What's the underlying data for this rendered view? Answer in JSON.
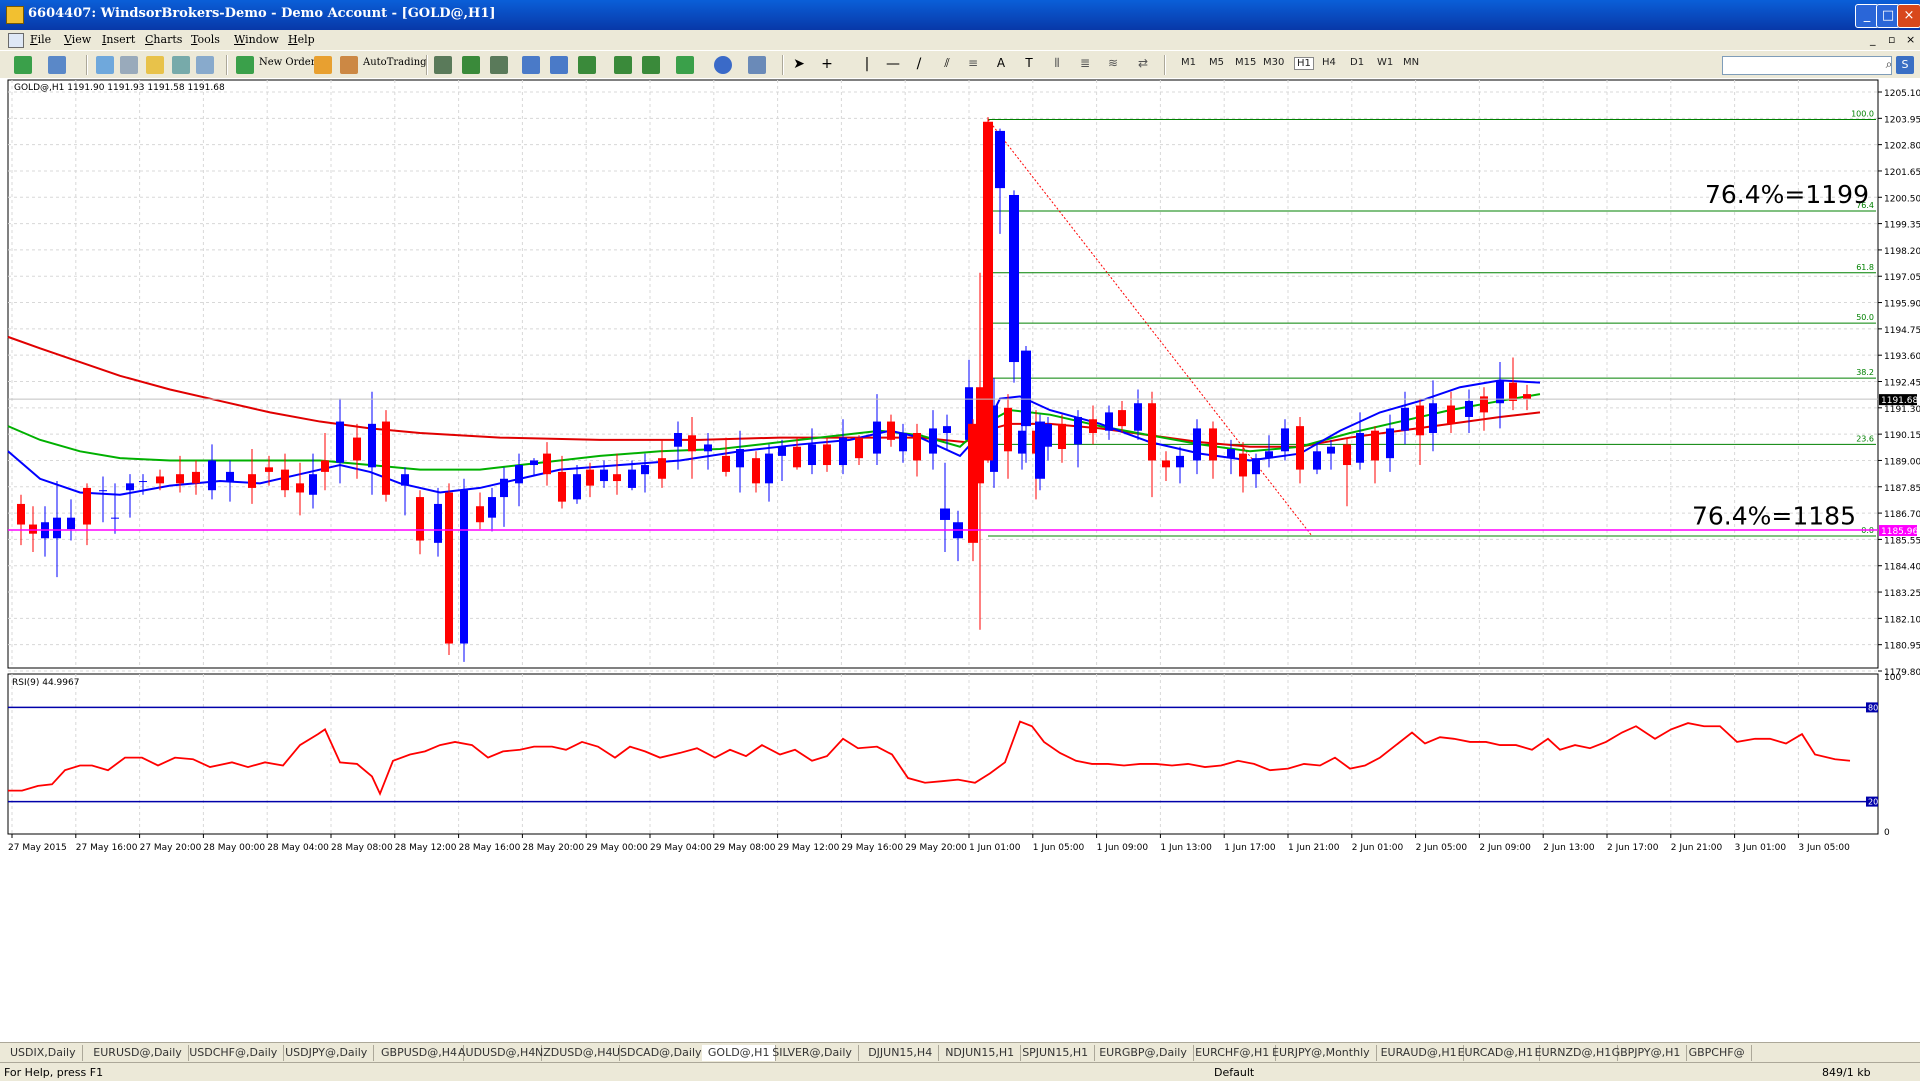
{
  "window": {
    "title": "6604407: WindsorBrokers-Demo - Demo Account - [GOLD@,H1]"
  },
  "menu": {
    "items": [
      "File",
      "View",
      "Insert",
      "Charts",
      "Tools",
      "Window",
      "Help"
    ]
  },
  "toolbar": {
    "new_order": "New Order",
    "autotrading": "AutoTrading",
    "periods": [
      "M1",
      "M5",
      "M15",
      "M30",
      "H1",
      "H4",
      "D1",
      "W1",
      "MN"
    ]
  },
  "chart": {
    "header": "GOLD@,H1  1191.90 1191.93 1191.58 1191.68",
    "price_labels": [
      "1205.10",
      "1203.95",
      "1202.80",
      "1201.65",
      "1200.50",
      "1199.35",
      "1198.20",
      "1197.05",
      "1195.90",
      "1194.75",
      "1193.60",
      "1192.45",
      "1191.30",
      "1190.15",
      "1189.00",
      "1187.85",
      "1186.70",
      "1185.55",
      "1184.40",
      "1183.25",
      "1182.10",
      "1180.95",
      "1179.80"
    ],
    "current_price": "1191.68",
    "support_price": "1185.96",
    "time_labels": [
      "27 May 2015",
      "27 May 16:00",
      "27 May 20:00",
      "28 May 00:00",
      "28 May 04:00",
      "28 May 08:00",
      "28 May 12:00",
      "28 May 16:00",
      "28 May 20:00",
      "29 May 00:00",
      "29 May 04:00",
      "29 May 08:00",
      "29 May 12:00",
      "29 May 16:00",
      "29 May 20:00",
      "1 Jun 01:00",
      "1 Jun 05:00",
      "1 Jun 09:00",
      "1 Jun 13:00",
      "1 Jun 17:00",
      "1 Jun 21:00",
      "2 Jun 01:00",
      "2 Jun 05:00",
      "2 Jun 09:00",
      "2 Jun 13:00",
      "2 Jun 17:00",
      "2 Jun 21:00",
      "3 Jun 01:00",
      "3 Jun 05:00"
    ],
    "fib_levels": [
      "100.0",
      "76.4",
      "61.8",
      "50.0",
      "38.2",
      "23.6",
      "0.0"
    ],
    "annotation_top": "76.4%=1199",
    "annotation_bottom": "76.4%=1185",
    "colors": {
      "bull": "#0000ff",
      "bear": "#ff0000",
      "ma_blue": "#0000ff",
      "ma_green": "#00b000",
      "ma_red": "#e00000",
      "fib": "#008000",
      "support": "#ff00ff"
    }
  },
  "rsi": {
    "header": "RSI(9) 44.9967",
    "scale_top": "100",
    "scale_bottom": "0",
    "level_high": "80",
    "level_low": "20"
  },
  "tabs": [
    "USDIX,Daily",
    "EURUSD@,Daily",
    "USDCHF@,Daily",
    "USDJPY@,Daily",
    "GBPUSD@,H4",
    "AUDUSD@,H4",
    "NZDUSD@,H4",
    "USDCAD@,Daily",
    "GOLD@,H1",
    "SILVER@,Daily",
    "DJJUN15,H4",
    "NDJUN15,H1",
    "SPJUN15,H1",
    "EURGBP@,Daily",
    "EURCHF@,H1",
    "EURJPY@,Monthly",
    "EURAUD@,H1",
    "EURCAD@,H1",
    "EURNZD@,H1",
    "GBPJPY@,H1",
    "GBPCHF@"
  ],
  "status": {
    "help": "For Help, press F1",
    "profile": "Default",
    "traffic": "849/1 kb"
  }
}
